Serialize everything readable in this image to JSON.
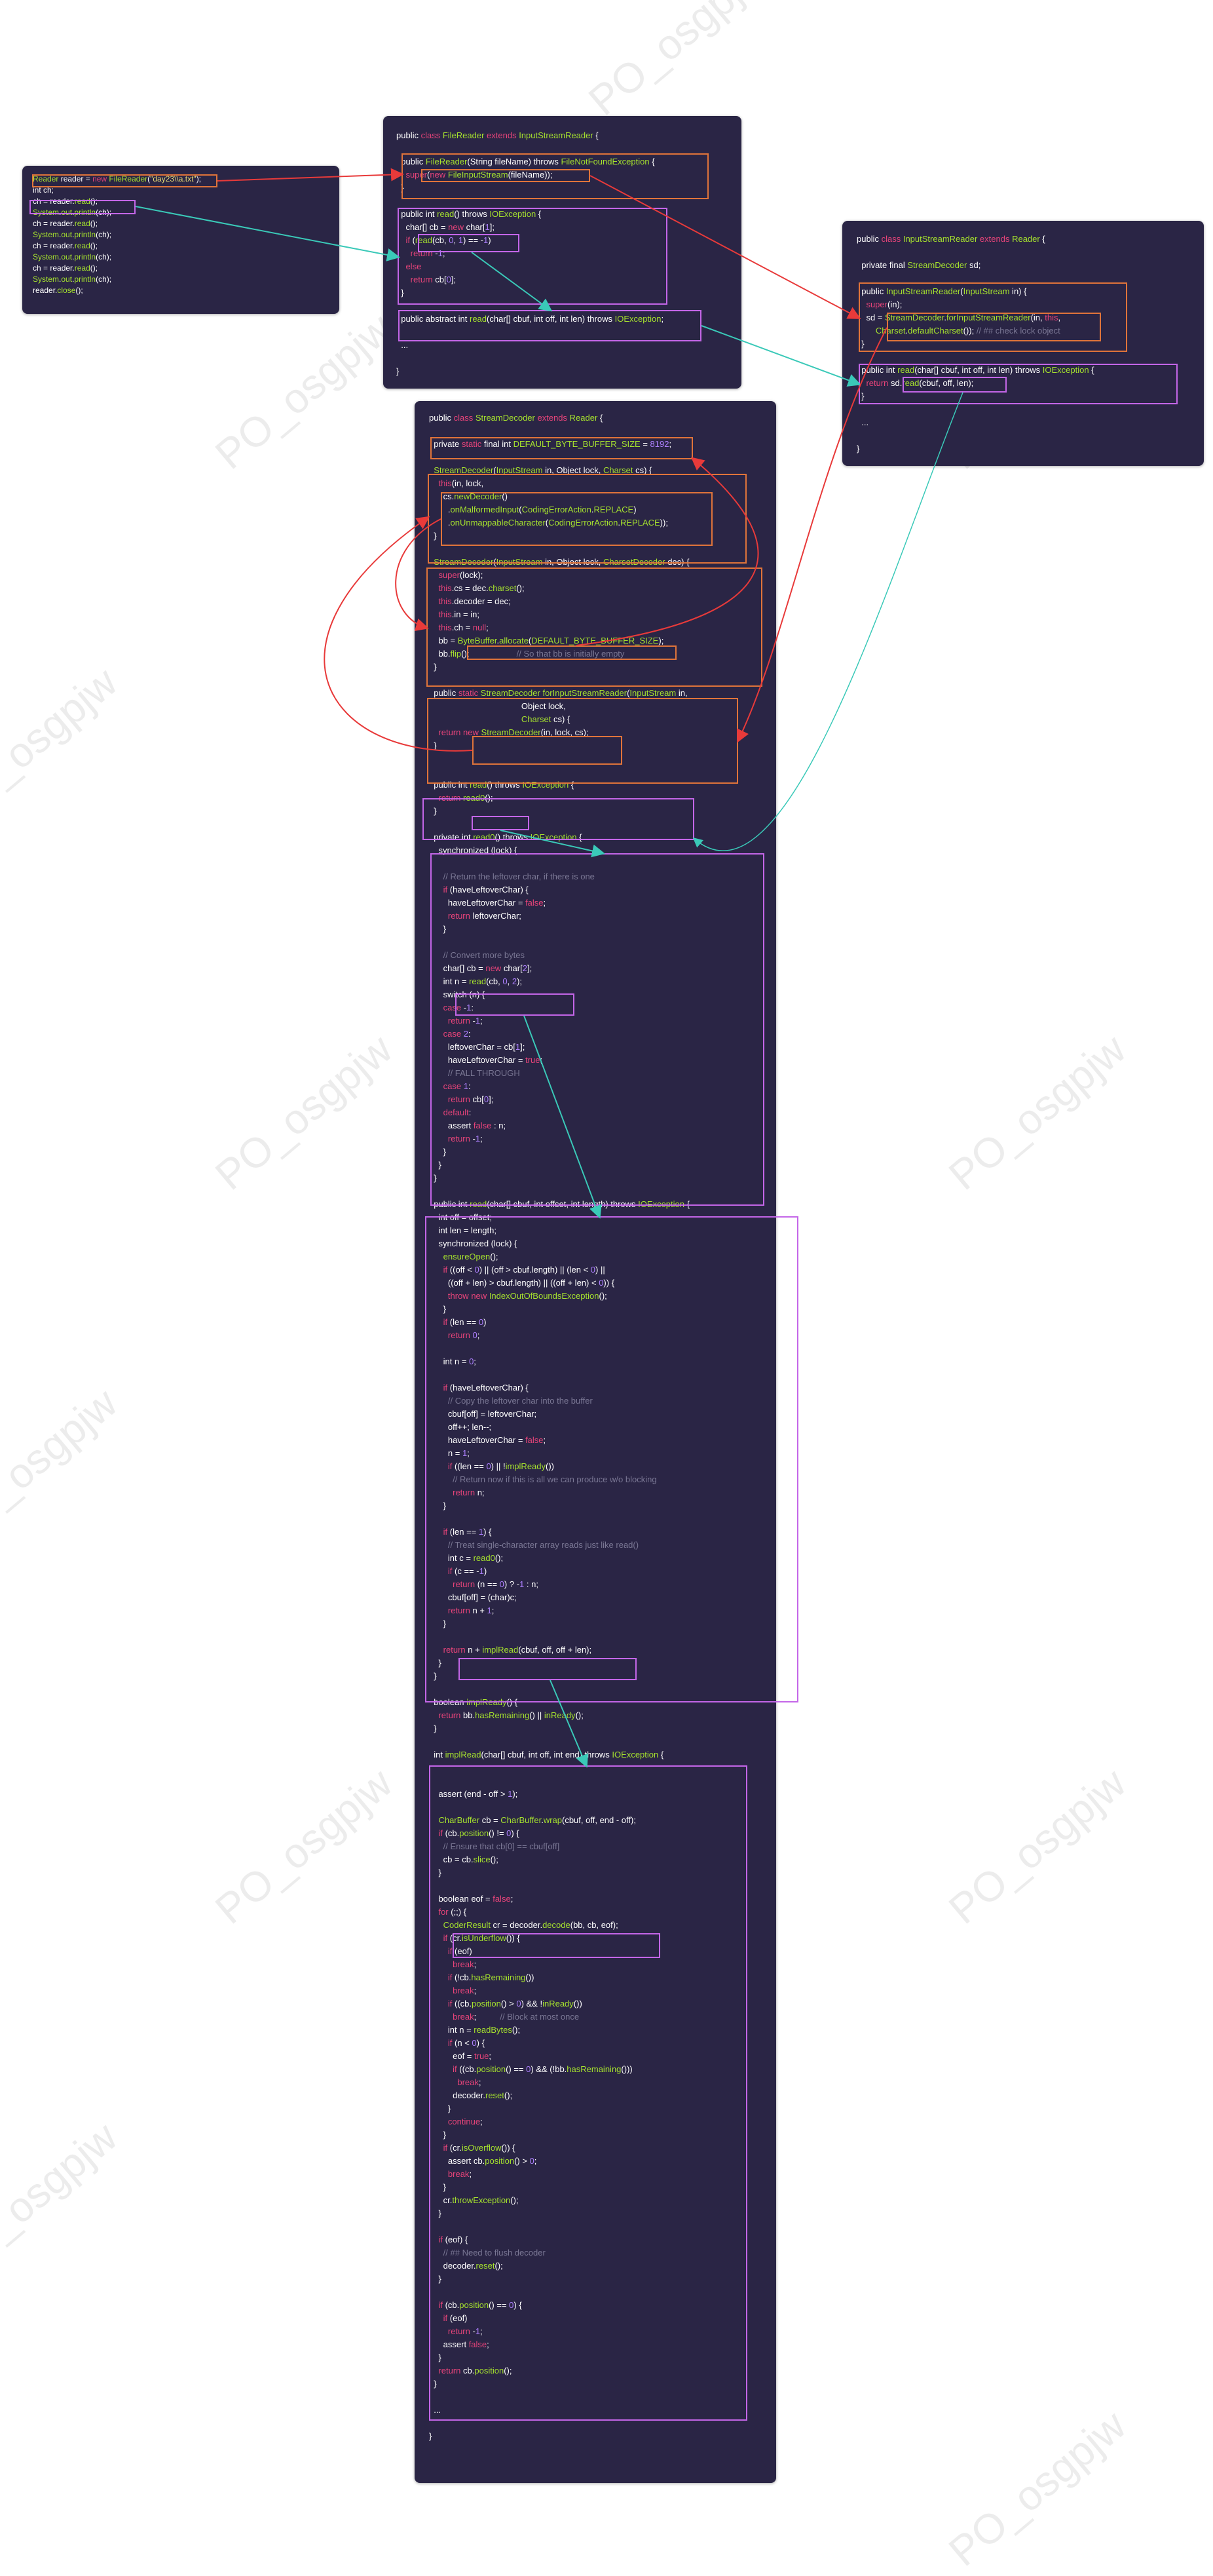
{
  "watermark": "PO_osgpjw",
  "panels": {
    "main": [
      "Reader reader = new FileReader(\"day23\\\\a.txt\");",
      "int ch;",
      "ch = reader.read();",
      "System.out.println(ch);",
      "ch = reader.read();",
      "System.out.println(ch);",
      "ch = reader.read();",
      "System.out.println(ch);",
      "ch = reader.read();",
      "System.out.println(ch);",
      "reader.close();"
    ],
    "filereader": [
      "public class FileReader extends InputStreamReader {",
      "",
      "  public FileReader(String fileName) throws FileNotFoundException {",
      "    super(new FileInputStream(fileName));",
      "  }",
      "",
      "  public int read() throws IOException {",
      "    char[] cb = new char[1];",
      "    if (read(cb, 0, 1) == -1)",
      "      return -1;",
      "    else",
      "      return cb[0];",
      "  }",
      "",
      "  public abstract int read(char[] cbuf, int off, int len) throws IOException;",
      "",
      "  ...",
      "",
      "}"
    ],
    "inputstreamreader": [
      "public class InputStreamReader extends Reader {",
      "",
      "  private final StreamDecoder sd;",
      "",
      "  public InputStreamReader(InputStream in) {",
      "    super(in);",
      "    sd = StreamDecoder.forInputStreamReader(in, this,",
      "        Charset.defaultCharset()); // ## check lock object",
      "  }",
      "",
      "  public int read(char[] cbuf, int off, int len) throws IOException {",
      "    return sd.read(cbuf, off, len);",
      "  }",
      "",
      "  ...",
      "",
      "}"
    ],
    "streamdecoder": [
      "public class StreamDecoder extends Reader {",
      "",
      "  private static final int DEFAULT_BYTE_BUFFER_SIZE = 8192;",
      "",
      "  StreamDecoder(InputStream in, Object lock, Charset cs) {",
      "    this(in, lock,",
      "      cs.newDecoder()",
      "        .onMalformedInput(CodingErrorAction.REPLACE)",
      "        .onUnmappableCharacter(CodingErrorAction.REPLACE));",
      "  }",
      "",
      "  StreamDecoder(InputStream in, Object lock, CharsetDecoder dec) {",
      "    super(lock);",
      "    this.cs = dec.charset();",
      "    this.decoder = dec;",
      "    this.in = in;",
      "    this.ch = null;",
      "    bb = ByteBuffer.allocate(DEFAULT_BYTE_BUFFER_SIZE);",
      "    bb.flip();                    // So that bb is initially empty",
      "  }",
      "",
      "  public static StreamDecoder forInputStreamReader(InputStream in,",
      "                                       Object lock,",
      "                                       Charset cs) {",
      "    return new StreamDecoder(in, lock, cs);",
      "  }",
      "",
      "",
      "  public int read() throws IOException {",
      "    return read0();",
      "  }",
      "",
      "  private int read0() throws IOException {",
      "    synchronized (lock) {",
      "",
      "      // Return the leftover char, if there is one",
      "      if (haveLeftoverChar) {",
      "        haveLeftoverChar = false;",
      "        return leftoverChar;",
      "      }",
      "",
      "      // Convert more bytes",
      "      char[] cb = new char[2];",
      "      int n = read(cb, 0, 2);",
      "      switch (n) {",
      "      case -1:",
      "        return -1;",
      "      case 2:",
      "        leftoverChar = cb[1];",
      "        haveLeftoverChar = true;",
      "        // FALL THROUGH",
      "      case 1:",
      "        return cb[0];",
      "      default:",
      "        assert false : n;",
      "        return -1;",
      "      }",
      "    }",
      "  }",
      "",
      "  public int read(char[] cbuf, int offset, int length) throws IOException {",
      "    int off = offset;",
      "    int len = length;",
      "    synchronized (lock) {",
      "      ensureOpen();",
      "      if ((off < 0) || (off > cbuf.length) || (len < 0) ||",
      "        ((off + len) > cbuf.length) || ((off + len) < 0)) {",
      "        throw new IndexOutOfBoundsException();",
      "      }",
      "      if (len == 0)",
      "        return 0;",
      "",
      "      int n = 0;",
      "",
      "      if (haveLeftoverChar) {",
      "        // Copy the leftover char into the buffer",
      "        cbuf[off] = leftoverChar;",
      "        off++; len--;",
      "        haveLeftoverChar = false;",
      "        n = 1;",
      "        if ((len == 0) || !implReady())",
      "          // Return now if this is all we can produce w/o blocking",
      "          return n;",
      "      }",
      "",
      "      if (len == 1) {",
      "        // Treat single-character array reads just like read()",
      "        int c = read0();",
      "        if (c == -1)",
      "          return (n == 0) ? -1 : n;",
      "        cbuf[off] = (char)c;",
      "        return n + 1;",
      "      }",
      "",
      "      return n + implRead(cbuf, off, off + len);",
      "    }",
      "  }",
      "",
      "  boolean implReady() {",
      "    return bb.hasRemaining() || inReady();",
      "  }",
      "",
      "  int implRead(char[] cbuf, int off, int end) throws IOException {",
      "",
      "",
      "    assert (end - off > 1);",
      "",
      "    CharBuffer cb = CharBuffer.wrap(cbuf, off, end - off);",
      "    if (cb.position() != 0) {",
      "      // Ensure that cb[0] == cbuf[off]",
      "      cb = cb.slice();",
      "    }",
      "",
      "    boolean eof = false;",
      "    for (;;) {",
      "      CoderResult cr = decoder.decode(bb, cb, eof);",
      "      if (cr.isUnderflow()) {",
      "        if (eof)",
      "          break;",
      "        if (!cb.hasRemaining())",
      "          break;",
      "        if ((cb.position() > 0) && !inReady())",
      "          break;          // Block at most once",
      "        int n = readBytes();",
      "        if (n < 0) {",
      "          eof = true;",
      "          if ((cb.position() == 0) && (!bb.hasRemaining()))",
      "            break;",
      "          decoder.reset();",
      "        }",
      "        continue;",
      "      }",
      "      if (cr.isOverflow()) {",
      "        assert cb.position() > 0;",
      "        break;",
      "      }",
      "      cr.throwException();",
      "    }",
      "",
      "    if (eof) {",
      "      // ## Need to flush decoder",
      "      decoder.reset();",
      "    }",
      "",
      "    if (cb.position() == 0) {",
      "      if (eof)",
      "        return -1;",
      "      assert false;",
      "    }",
      "    return cb.position();",
      "  }",
      "",
      "  ...",
      "",
      "}"
    ]
  },
  "colors": {
    "panel_bg": "#2a2545",
    "keyword": "#e8447a",
    "type": "#a6e22e",
    "comment": "#7a7794",
    "number": "#ae81ff",
    "string": "#e6db74",
    "box_purple": "#c466e8",
    "box_orange": "#e0743a",
    "arrow_red": "#e83a3a",
    "arrow_teal": "#3ac9b8"
  }
}
